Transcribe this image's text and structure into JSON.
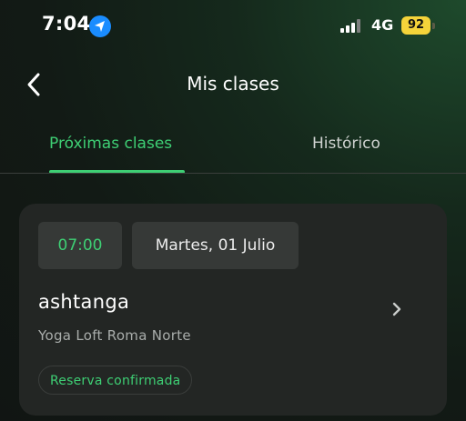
{
  "status_bar": {
    "time": "7:04",
    "network": "4G",
    "battery": "92",
    "location_icon": "location-arrow-icon",
    "signal_icon": "cellular-signal-icon",
    "battery_color": "#f5d33a"
  },
  "header": {
    "title": "Mis clases",
    "back_icon": "chevron-left-icon"
  },
  "tabs": [
    {
      "label": "Próximas clases",
      "active": true
    },
    {
      "label": "Histórico",
      "active": false
    }
  ],
  "colors": {
    "accent": "#3ecf74",
    "card_background": "#232624",
    "chip_background": "#363937"
  },
  "booking": {
    "time": "07:00",
    "date": "Martes, 01 Julio",
    "class_name": "ashtanga",
    "studio": "Yoga Loft Roma Norte",
    "status": "Reserva confirmada",
    "open_icon": "chevron-right-icon"
  }
}
